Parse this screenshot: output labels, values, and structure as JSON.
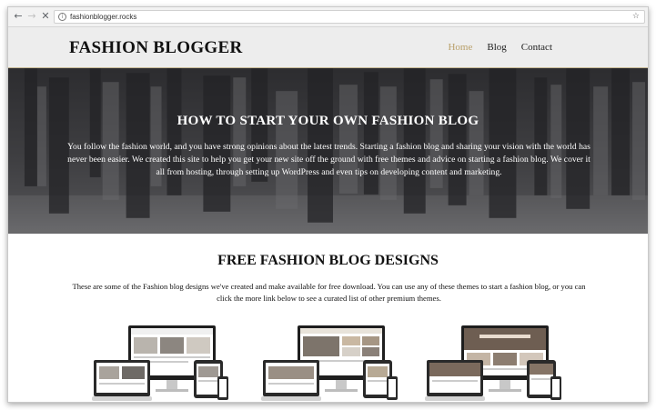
{
  "browser": {
    "url": "fashionblogger.rocks",
    "back_icon": "arrow-left-icon",
    "forward_icon": "arrow-right-icon",
    "reload_icon": "close-icon",
    "info_icon": "info-icon",
    "bookmark_icon": "star-icon"
  },
  "header": {
    "logo": "FASHION BLOGGER",
    "nav": [
      {
        "label": "Home",
        "active": true
      },
      {
        "label": "Blog",
        "active": false
      },
      {
        "label": "Contact",
        "active": false
      }
    ]
  },
  "hero": {
    "title": "HOW TO START YOUR OWN FASHION BLOG",
    "text": "You follow the fashion world, and you have strong opinions about the latest trends. Starting a fashion blog and sharing your vision with the world has never been easier. We created this site to help you get your new site off the ground with free themes and advice on starting a fashion blog. We cover it all from hosting, through setting up WordPress and even tips on developing content and marketing."
  },
  "designs": {
    "title": "FREE FASHION BLOG DESIGNS",
    "text": "These are some of the Fashion blog designs we've created and make available for free download. You can use any of these themes to start a fashion blog, or you can click the more link below to see a curated list of other premium themes."
  },
  "colors": {
    "accent": "#b9a06a",
    "header_bg": "#ededed",
    "hero_overlay": "#3d3d40"
  }
}
